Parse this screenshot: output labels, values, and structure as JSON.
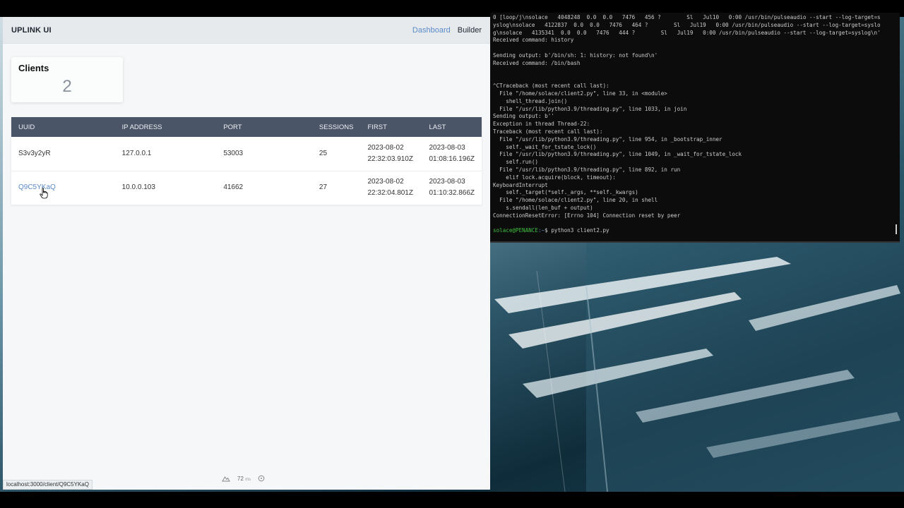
{
  "browser": {
    "brand": "UPLINK UI",
    "nav": {
      "dashboard": "Dashboard",
      "builder": "Builder"
    },
    "stat": {
      "title": "Clients",
      "value": "2"
    },
    "table": {
      "columns": [
        "UUID",
        "IP ADDRESS",
        "PORT",
        "SESSIONS",
        "FIRST",
        "LAST"
      ],
      "rows": [
        {
          "uuid": "S3v3y2yR",
          "ip": "127.0.0.1",
          "port": "53003",
          "sessions": "25",
          "first_date": "2023-08-02",
          "first_time": "22:32:03.910Z",
          "last_date": "2023-08-03",
          "last_time": "01:08:16.196Z"
        },
        {
          "uuid": "Q9C5YKaQ",
          "ip": "10.0.0.103",
          "port": "41662",
          "sessions": "27",
          "first_date": "2023-08-02",
          "first_time": "22:32:04.801Z",
          "last_date": "2023-08-03",
          "last_time": "01:10:32.866Z"
        }
      ]
    },
    "status_url": "localhost:3000/client/Q9C5YKaQ",
    "timing": {
      "value": "72",
      "unit": "ms"
    }
  },
  "terminal": {
    "lines": [
      "0 [loop/j\\nsolace   4048248  0.0  0.0   7476   456 ?        Sl   Jul10   0:00 /usr/bin/pulseaudio --start --log-target=s",
      "yslog\\nsolace   4122837  0.0  0.0   7476   464 ?        Sl   Jul19   0:00 /usr/bin/pulseaudio --start --log-target=syslo",
      "g\\nsolace   4135341  0.0  0.0   7476   444 ?        Sl   Jul19   0:00 /usr/bin/pulseaudio --start --log-target=syslog\\n'",
      "Received command: history",
      "",
      "Sending output: b'/bin/sh: 1: history: not found\\n'",
      "Received command: /bin/bash",
      "",
      "",
      "^CTraceback (most recent call last):",
      "  File \"/home/solace/client2.py\", line 33, in <module>",
      "    shell_thread.join()",
      "  File \"/usr/lib/python3.9/threading.py\", line 1033, in join",
      "Sending output: b''",
      "Exception in thread Thread-22:",
      "Traceback (most recent call last):",
      "  File \"/usr/lib/python3.9/threading.py\", line 954, in _bootstrap_inner",
      "    self._wait_for_tstate_lock()",
      "  File \"/usr/lib/python3.9/threading.py\", line 1049, in _wait_for_tstate_lock",
      "    self.run()",
      "  File \"/usr/lib/python3.9/threading.py\", line 892, in run",
      "    elif lock.acquire(block, timeout):",
      "KeyboardInterrupt",
      "    self._target(*self._args, **self._kwargs)",
      "  File \"/home/solace/client2.py\", line 20, in shell",
      "    s.sendall(len_buf + output)",
      "ConnectionResetError: [Errno 104] Connection reset by peer",
      ""
    ],
    "prompt": {
      "user": "solace@PENANCE",
      "path": ":~",
      "command": "$ python3 client2.py"
    }
  },
  "colors": {
    "accent": "#5a8ac9",
    "table_header": "#4a5568",
    "prompt_user": "#3fc13f"
  }
}
